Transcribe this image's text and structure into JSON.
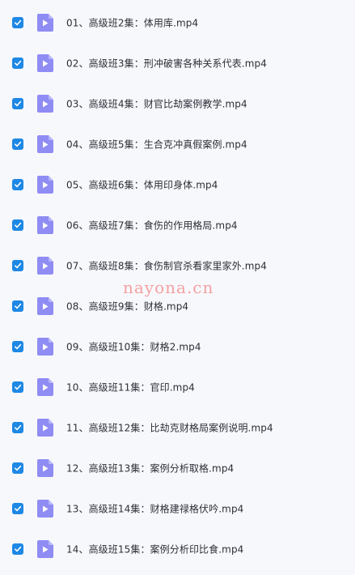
{
  "files": [
    {
      "name": "01、高级班2集：体用库.mp4",
      "checked": true
    },
    {
      "name": "02、高级班3集：刑冲破害各种关系代表.mp4",
      "checked": true
    },
    {
      "name": "03、高级班4集：财官比劫案例教学.mp4",
      "checked": true
    },
    {
      "name": "04、高级班5集：生合克冲真假案例.mp4",
      "checked": true
    },
    {
      "name": "05、高级班6集：体用印身体.mp4",
      "checked": true
    },
    {
      "name": "06、高级班7集：食伤的作用格局.mp4",
      "checked": true
    },
    {
      "name": "07、高级班8集：食伤制官杀看家里家外.mp4",
      "checked": true
    },
    {
      "name": "08、高级班9集：财格.mp4",
      "checked": true
    },
    {
      "name": "09、高级班10集：财格2.mp4",
      "checked": true
    },
    {
      "name": "10、高级班11集：官印.mp4",
      "checked": true
    },
    {
      "name": "11、高级班12集：比劫克财格局案例说明.mp4",
      "checked": true
    },
    {
      "name": "12、高级班13集：案例分析取格.mp4",
      "checked": true
    },
    {
      "name": "13、高级班14集：财格建禄格伏吟.mp4",
      "checked": true
    },
    {
      "name": "14、高级班15集：案例分析印比食.mp4",
      "checked": true
    }
  ],
  "watermark": "nayona.cn",
  "colors": {
    "checkbox": "#1e88e5",
    "file_icon": "#8f8cf4",
    "watermark": "#f4a0a0"
  },
  "icons": {
    "checkbox": "checkmark-icon",
    "file": "video-file-icon"
  }
}
